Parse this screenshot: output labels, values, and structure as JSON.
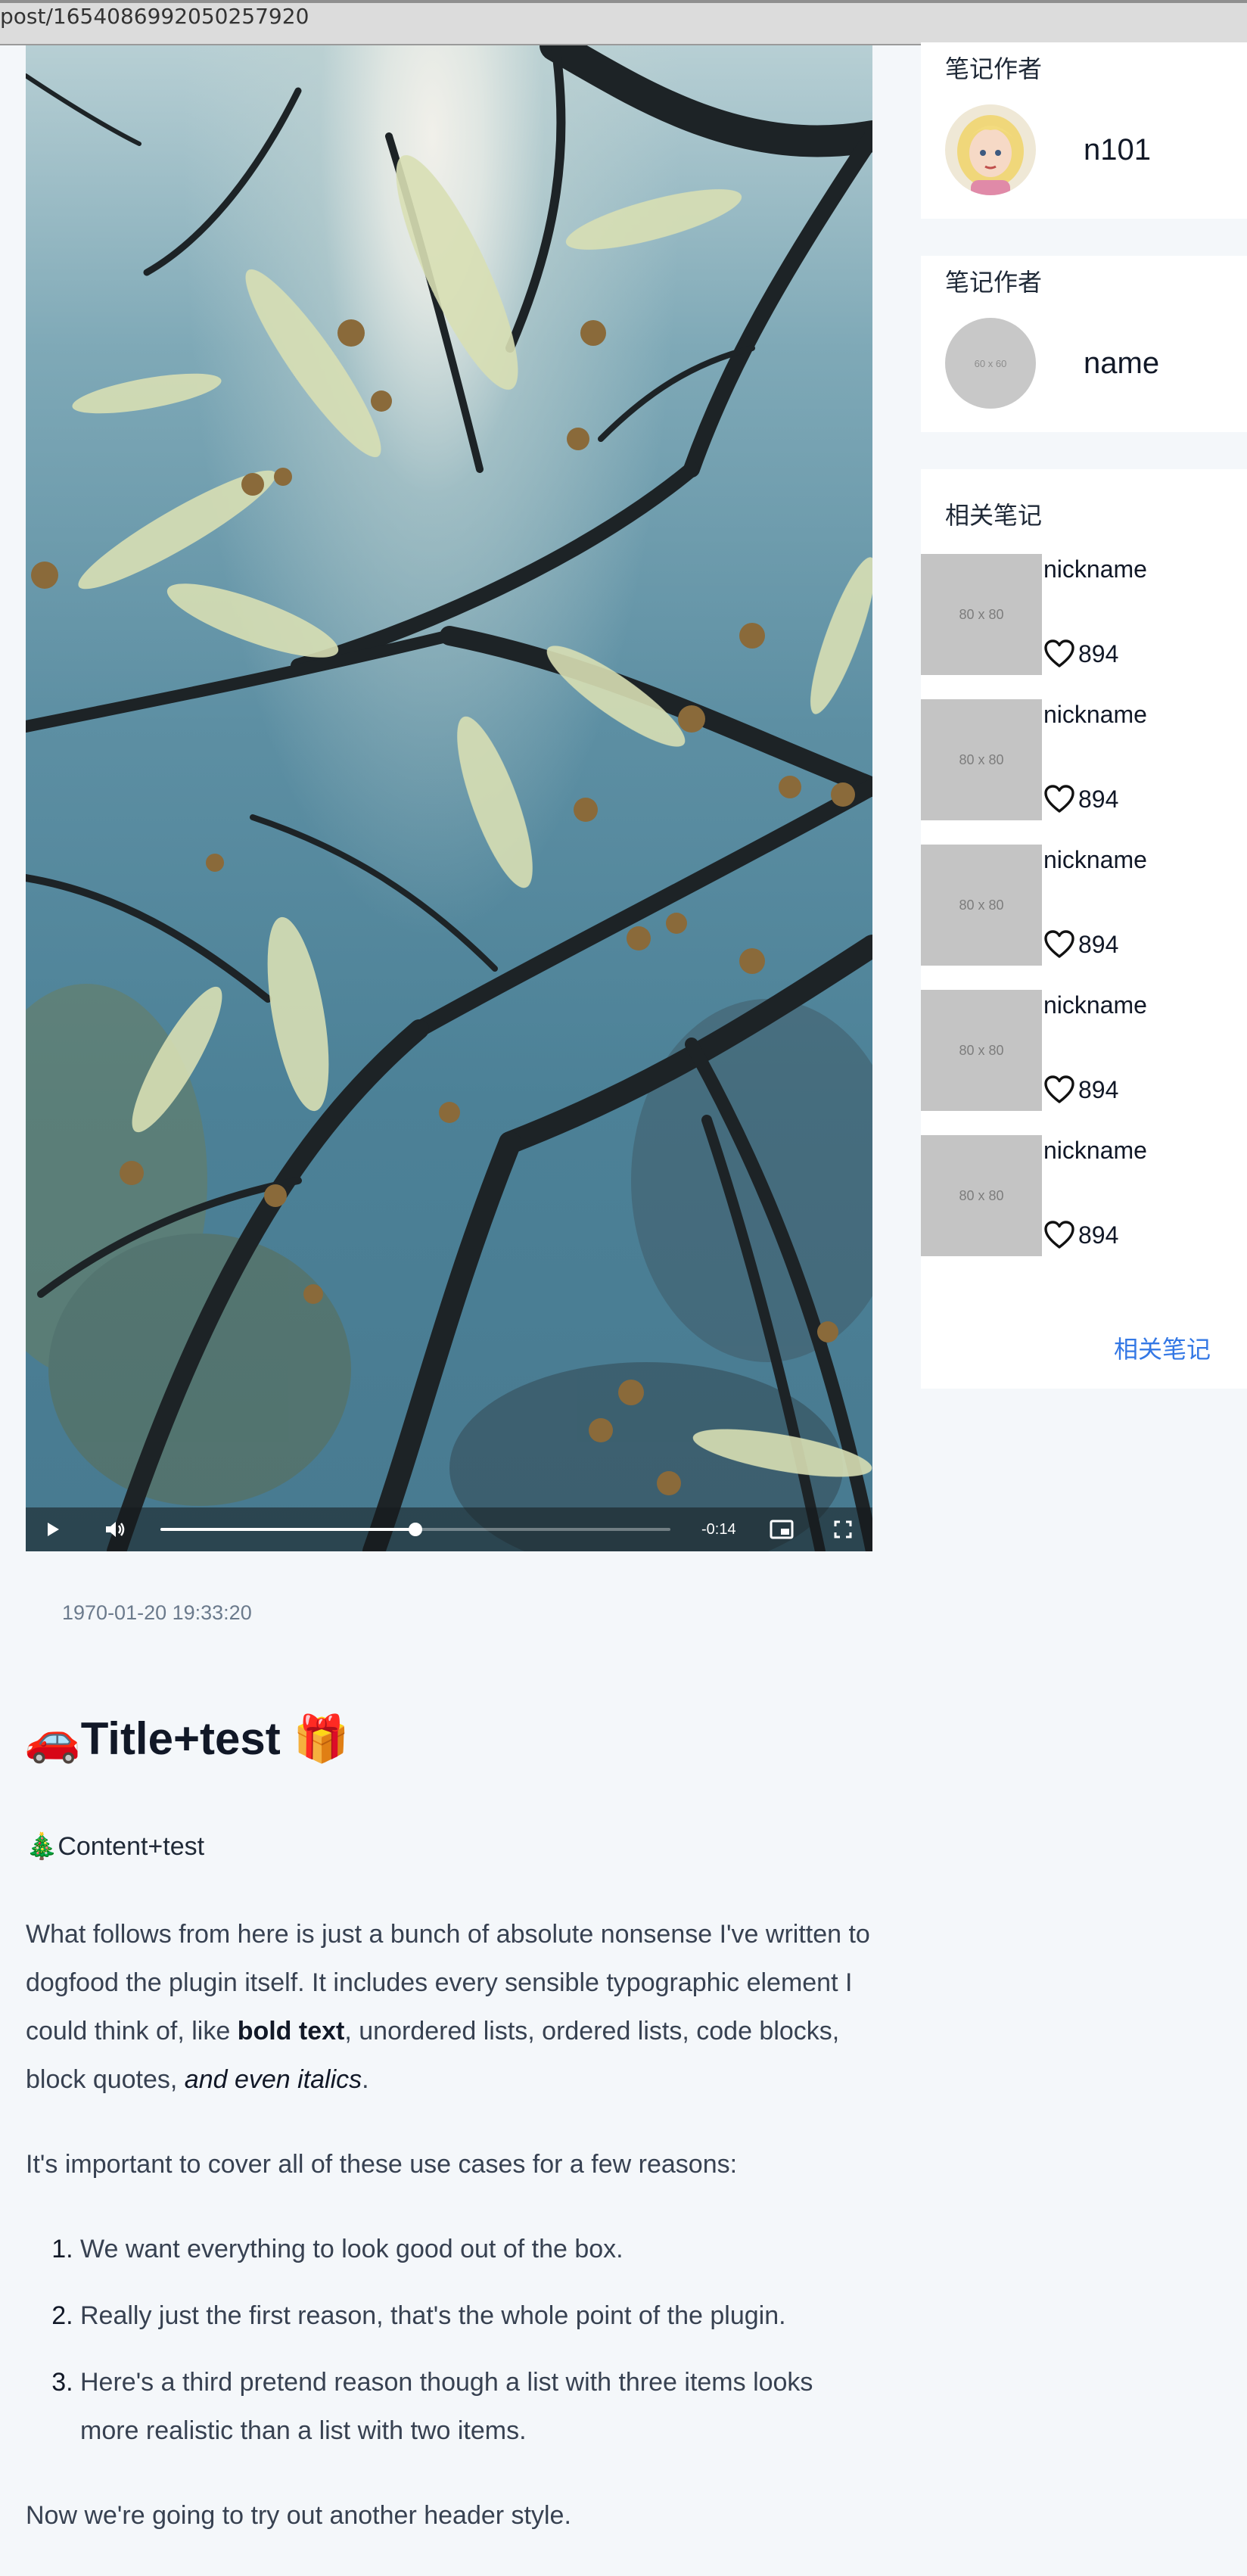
{
  "browser": {
    "url": "post/1654086992050257920"
  },
  "video": {
    "time_remaining": "-0:14",
    "progress": 0.5
  },
  "post": {
    "date": "1970-01-20 19:33:20",
    "title_prefix_emoji": "🚗",
    "title": "Title+test",
    "title_suffix_emoji": "🎁",
    "content_emoji": "🎄",
    "content": "Content+test",
    "para1_a": "What follows from here is just a bunch of absolute nonsense I've written to dogfood the plugin itself. It includes every sensible typographic element I could think of, like ",
    "para1_bold": "bold text",
    "para1_b": ", unordered lists, ordered lists, code blocks, block quotes, ",
    "para1_italic": "and even italics",
    "para1_c": ".",
    "para2": "It's important to cover all of these use cases for a few reasons:",
    "list": [
      "We want everything to look good out of the box.",
      "Really just the first reason, that's the whole point of the plugin.",
      "Here's a third pretend reason though a list with three items looks more realistic than a list with two items."
    ],
    "para3": "Now we're going to try out another header style."
  },
  "sidebar": {
    "author_card_1": {
      "title": "笔记作者",
      "name": "n101"
    },
    "author_card_2": {
      "title": "笔记作者",
      "name": "name",
      "avatar_placeholder": "60 x 60"
    },
    "related": {
      "title": "相关笔记",
      "thumb_placeholder": "80 x 80",
      "items": [
        {
          "name": "nickname",
          "likes": "894"
        },
        {
          "name": "nickname",
          "likes": "894"
        },
        {
          "name": "nickname",
          "likes": "894"
        },
        {
          "name": "nickname",
          "likes": "894"
        },
        {
          "name": "nickname",
          "likes": "894"
        }
      ],
      "more_label": "相关笔记"
    }
  },
  "colors": {
    "link": "#3478e5",
    "background": "#f4f7fa",
    "card": "#ffffff"
  },
  "icons": [
    "play-icon",
    "volume-icon",
    "pip-icon",
    "fullscreen-icon",
    "heart-icon"
  ]
}
